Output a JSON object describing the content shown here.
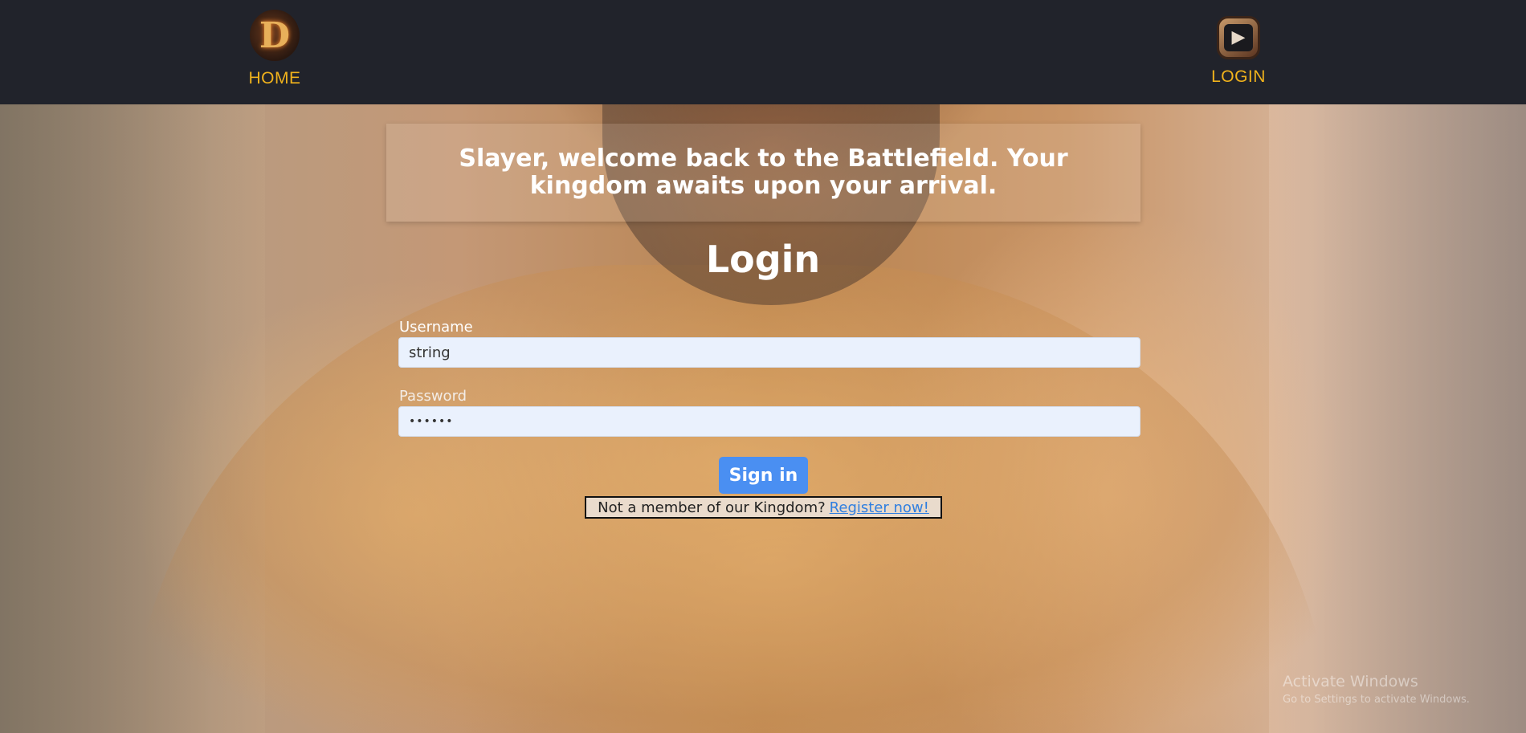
{
  "nav": {
    "home_label": "HOME",
    "home_icon": "d-logo-icon",
    "login_label": "LOGIN",
    "login_icon": "play-icon"
  },
  "banner": {
    "text": "Slayer, welcome back to the Battlefield. Your kingdom awaits upon your arrival."
  },
  "form": {
    "title": "Login",
    "username_label": "Username",
    "username_value": "string",
    "password_label": "Password",
    "password_value": "••••••",
    "submit_label": "Sign in",
    "register_prompt": "Not a member of our Kingdom?",
    "register_link": "Register now!"
  },
  "watermark": {
    "title": "Activate Windows",
    "subtitle": "Go to Settings to activate Windows."
  },
  "colors": {
    "nav_bg": "#21232b",
    "nav_text": "#f0b21c",
    "button": "#4a8ff2",
    "link": "#2f7fe0"
  }
}
